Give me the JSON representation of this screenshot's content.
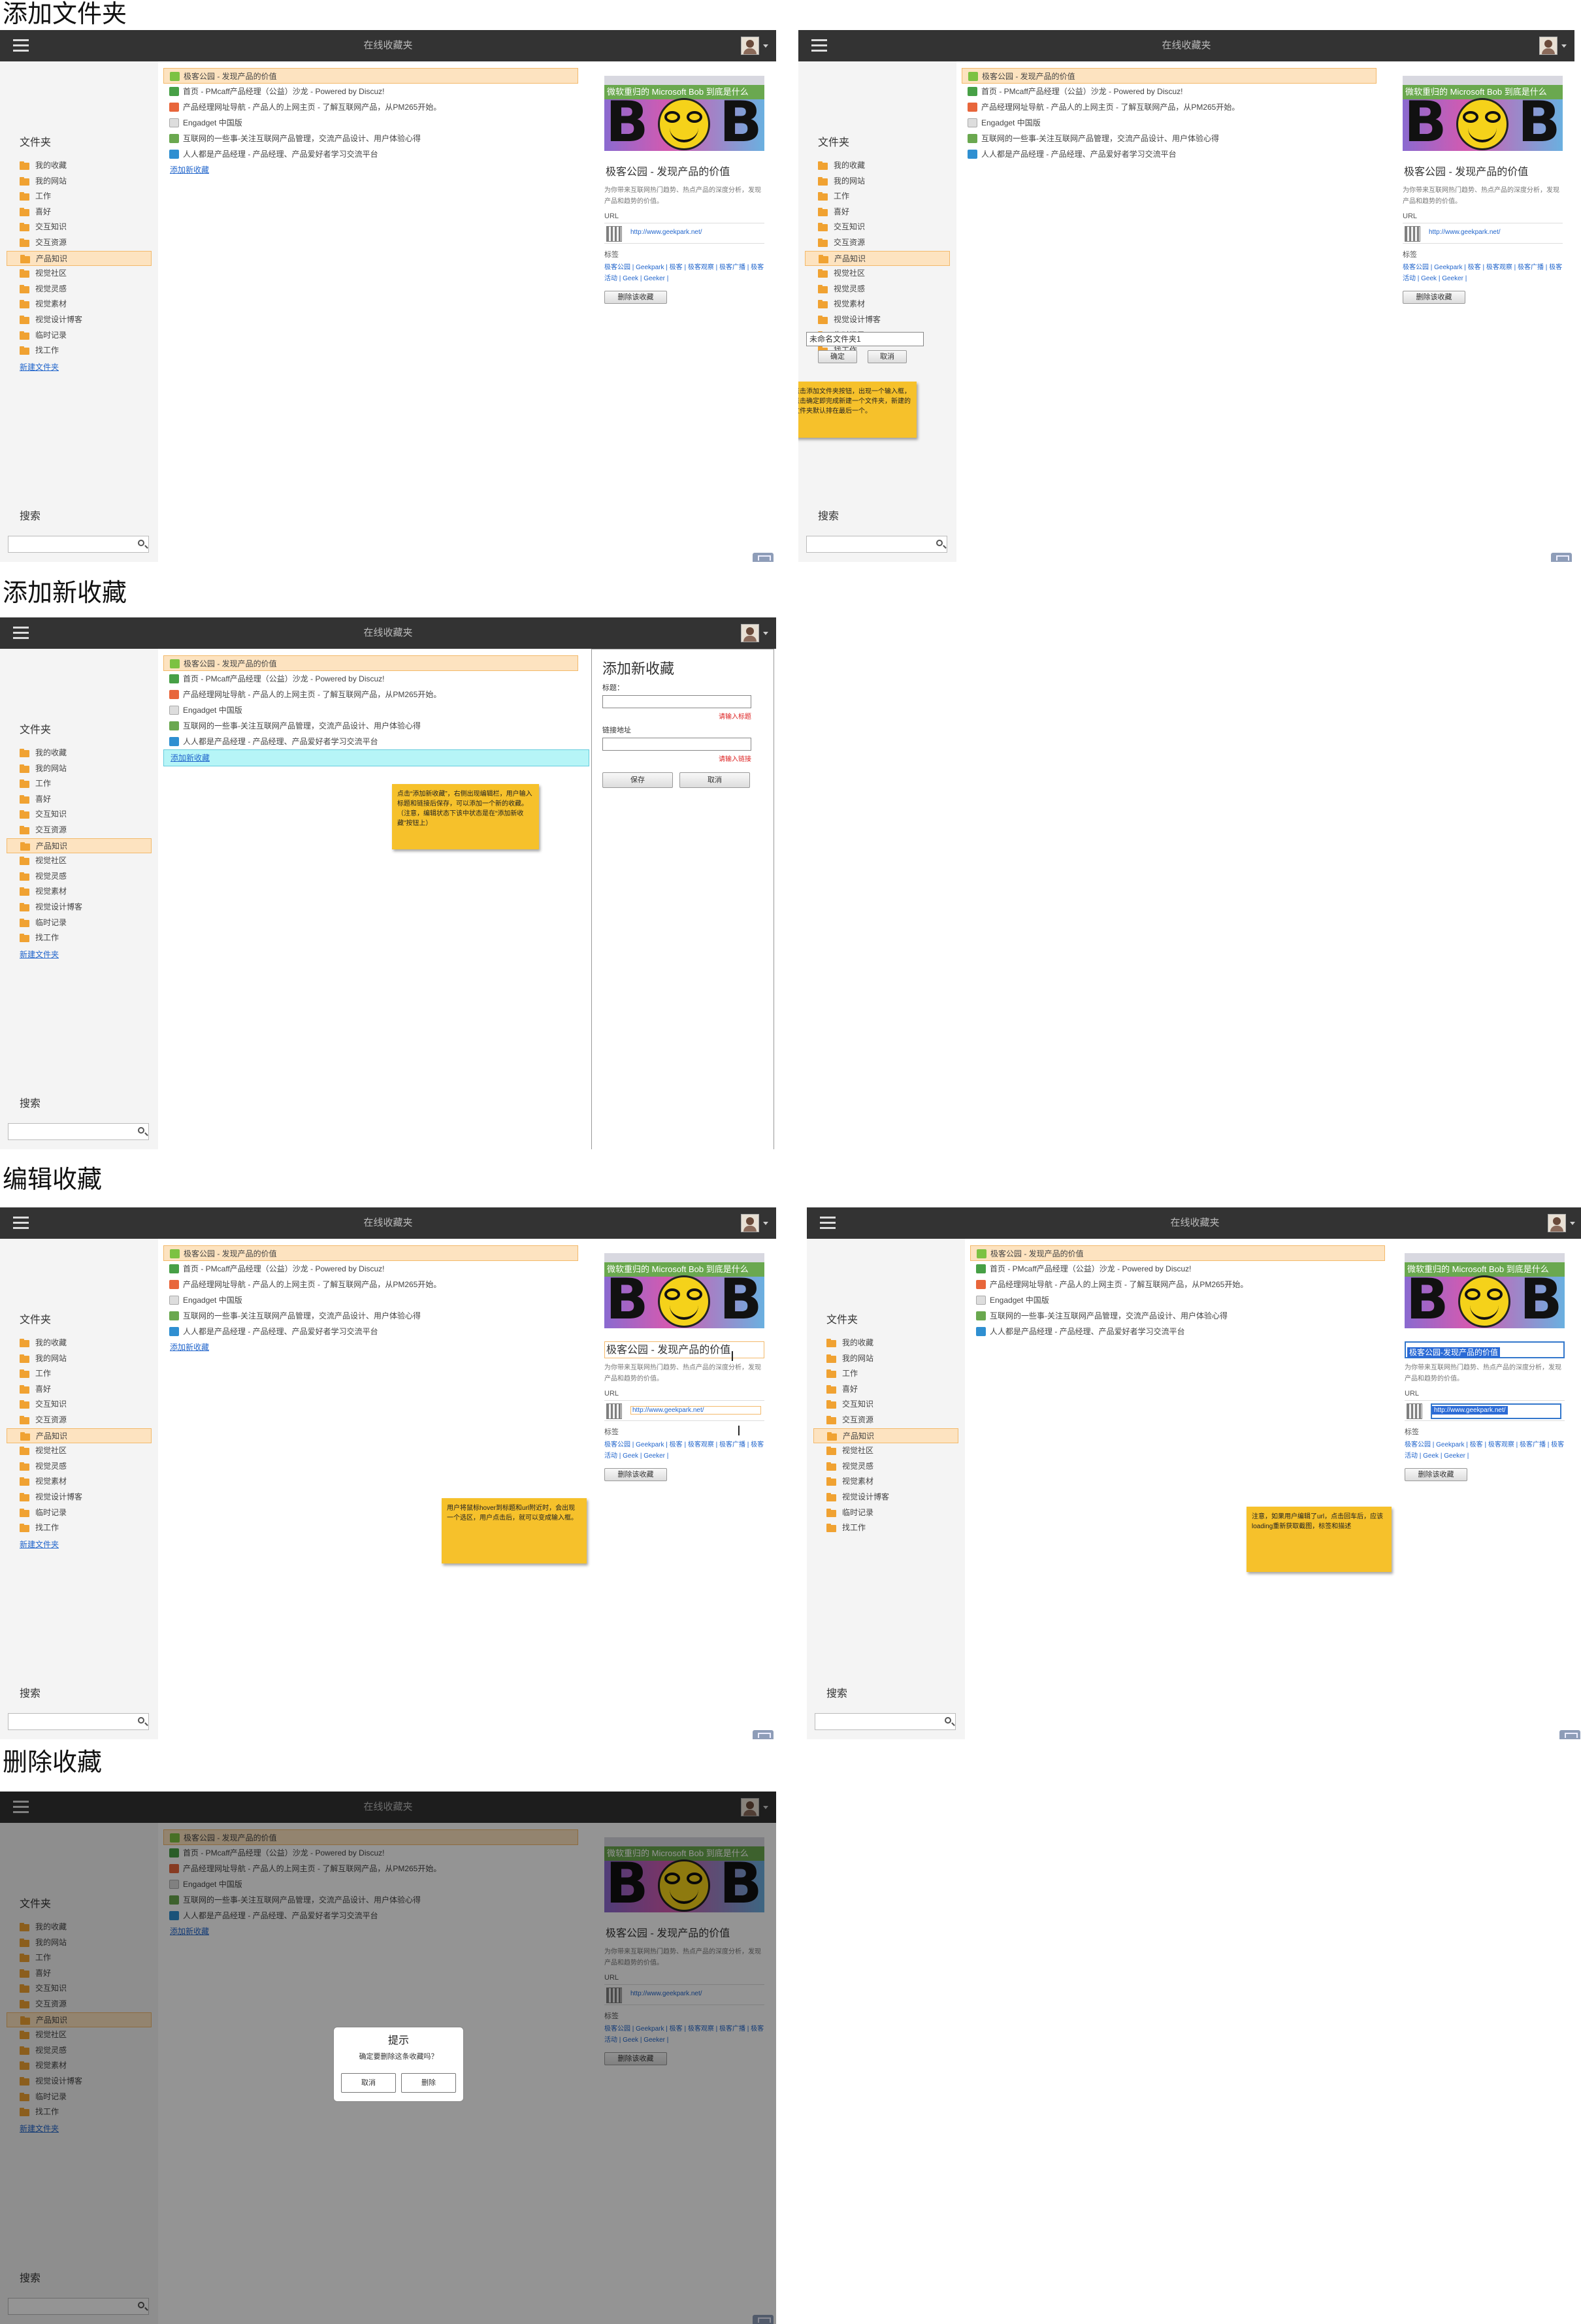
{
  "sections": {
    "add_folder": "添加文件夹",
    "add_bookmark": "添加新收藏",
    "edit_bookmark": "编辑收藏",
    "delete_bookmark": "删除收藏"
  },
  "app": {
    "title": "在线收藏夹",
    "folders_heading": "文件夹",
    "search_heading": "搜索",
    "new_folder_link": "新建文件夹",
    "add_bookmark_link": "添加新收藏"
  },
  "folders": [
    "我的收藏",
    "我的网站",
    "工作",
    "喜好",
    "交互知识",
    "交互资源",
    "产品知识",
    "视觉社区",
    "视觉灵感",
    "视觉素材",
    "视觉设计博客",
    "临时记录",
    "找工作"
  ],
  "selected_folder": "产品知识",
  "bookmarks": [
    {
      "text": "极客公园 - 发现产品的价值",
      "icon_color": "#7cc242"
    },
    {
      "text": "首页 - PMcaff产品经理（公益）沙龙 - Powered by Discuz!",
      "icon_color": "#47a046"
    },
    {
      "text": "产品经理网址导航 - 产品人的上网主页 - 了解互联网产品，从PM265开始。",
      "icon_color": "#e8663b"
    },
    {
      "text": "Engadget 中国版",
      "icon_color": "#dddddd"
    },
    {
      "text": "互联网的一些事-关注互联网产品管理，交流产品设计、用户体验心得",
      "icon_color": "#6aa84f"
    },
    {
      "text": "人人都是产品经理 - 产品经理、产品爱好者学习交流平台",
      "icon_color": "#2f8fd1"
    }
  ],
  "detail": {
    "thumb_caption": "微软重归的 Microsoft Bob 到底是什么",
    "title": "极客公园 - 发现产品的价值",
    "description": "为你带来互联网热门趋势、热点产品的深度分析，发现产品和趋势的价值。",
    "url_label": "URL",
    "url": "http://www.geekpark.net/",
    "tags_label": "标签",
    "tags": "极客公园 | Geekpark | 极客 | 极客观察 | 极客广播 | 极客活动 | Geek | Geeker |",
    "delete_button": "删除该收藏"
  },
  "new_folder": {
    "input_value": "未命名文件夹1",
    "confirm": "确定",
    "cancel": "取消"
  },
  "add_panel": {
    "heading": "添加新收藏",
    "title_label": "标题：",
    "title_error": "请输入标题",
    "url_label": "链接地址",
    "url_error": "请输入链接",
    "save": "保存",
    "cancel": "取消"
  },
  "edit_mode": {
    "title_value": "极客公园-发现产品的价值",
    "url_value": "http://www.geekpark.net/"
  },
  "delete_dialog": {
    "title": "提示",
    "message": "确定要删除这条收藏吗？",
    "cancel": "取消",
    "confirm": "删除"
  },
  "notes": {
    "add_folder": "点击添加文件夹按钮，出现一个输入框，点击确定即完成新建一个文件夹，新建的文件夹默认排在最后一个。",
    "add_bookmark": "点击“添加新收藏”，右侧出现编辑栏，用户输入标题和链接后保存，可以添加一个新的收藏。（注意，编辑状态下该中状态是在“添加新收藏”按钮上）",
    "edit_hover": "用户将鼠标hover到标题和url附近时，会出现一个选区，用户点击后，就可以变成输入框。",
    "edit_url": "注意，如果用户编辑了url，点击回车后，应该loading重新获取截图，标签和描述"
  },
  "colors": {
    "topbar": "#333333",
    "highlight": "#fde3c0",
    "link": "#2266cc",
    "note": "#f6c12b",
    "folder_icon": "#f0a232"
  }
}
